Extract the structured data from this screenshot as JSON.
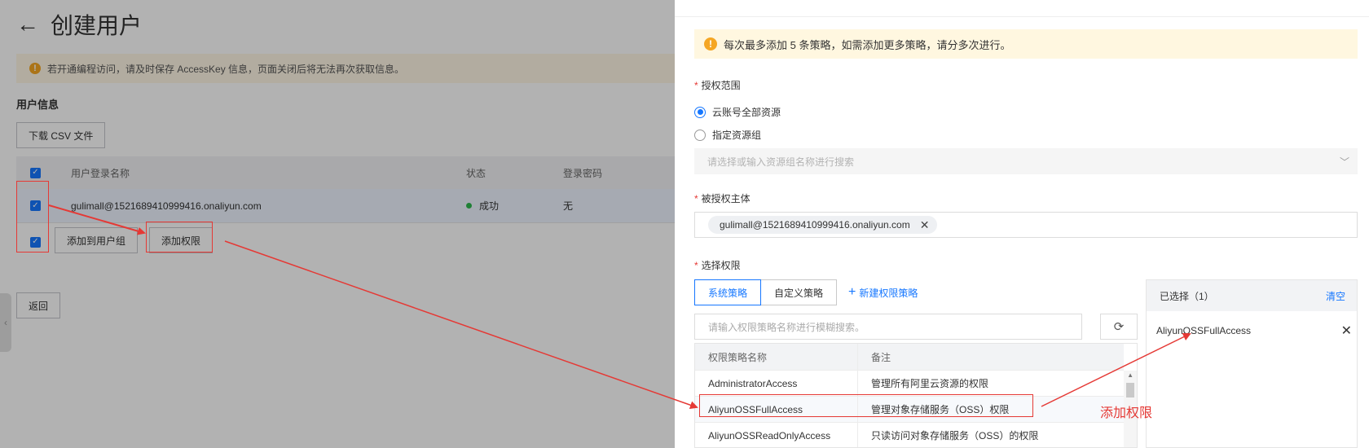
{
  "left_page": {
    "title": "创建用户",
    "notice": "若开通编程访问，请及时保存 AccessKey 信息，页面关闭后将无法再次获取信息。",
    "section_title": "用户信息",
    "download_csv": "下载 CSV 文件",
    "table": {
      "columns": [
        "用户登录名称",
        "状态",
        "登录密码"
      ],
      "rows": [
        {
          "login_name": "gulimall@1521689410999416.onaliyun.com",
          "status": "成功",
          "password": "无"
        }
      ]
    },
    "add_to_group": "添加到用户组",
    "add_permission": "添加权限",
    "return": "返回"
  },
  "right_panel": {
    "notice": "每次最多添加 5 条策略，如需添加更多策略，请分多次进行。",
    "scope_label": "授权范围",
    "scope_options": [
      "云账号全部资源",
      "指定资源组"
    ],
    "scope_selected": "云账号全部资源",
    "resource_group_placeholder": "请选择或输入资源组名称进行搜索",
    "principal_label": "被授权主体",
    "principal_tag": "gulimall@1521689410999416.onaliyun.com",
    "permission_label": "选择权限",
    "tabs": [
      "系统策略",
      "自定义策略"
    ],
    "active_tab": "系统策略",
    "new_policy": "新建权限策略",
    "search_placeholder": "请输入权限策略名称进行模糊搜索。",
    "policy_table": {
      "columns": [
        "权限策略名称",
        "备注"
      ],
      "rows": [
        {
          "name": "AdministratorAccess",
          "note": "管理所有阿里云资源的权限"
        },
        {
          "name": "AliyunOSSFullAccess",
          "note": "管理对象存储服务（OSS）权限"
        },
        {
          "name": "AliyunOSSReadOnlyAccess",
          "note": "只读访问对象存储服务（OSS）的权限"
        }
      ]
    },
    "selected": {
      "title": "已选择（1）",
      "clear": "清空",
      "items": [
        "AliyunOSSFullAccess"
      ]
    }
  },
  "annotation": {
    "text": "添加权限",
    "color": "#e53935"
  },
  "colors": {
    "accent": "#1677ff",
    "warning": "#f5a623",
    "success": "#2db84d"
  }
}
